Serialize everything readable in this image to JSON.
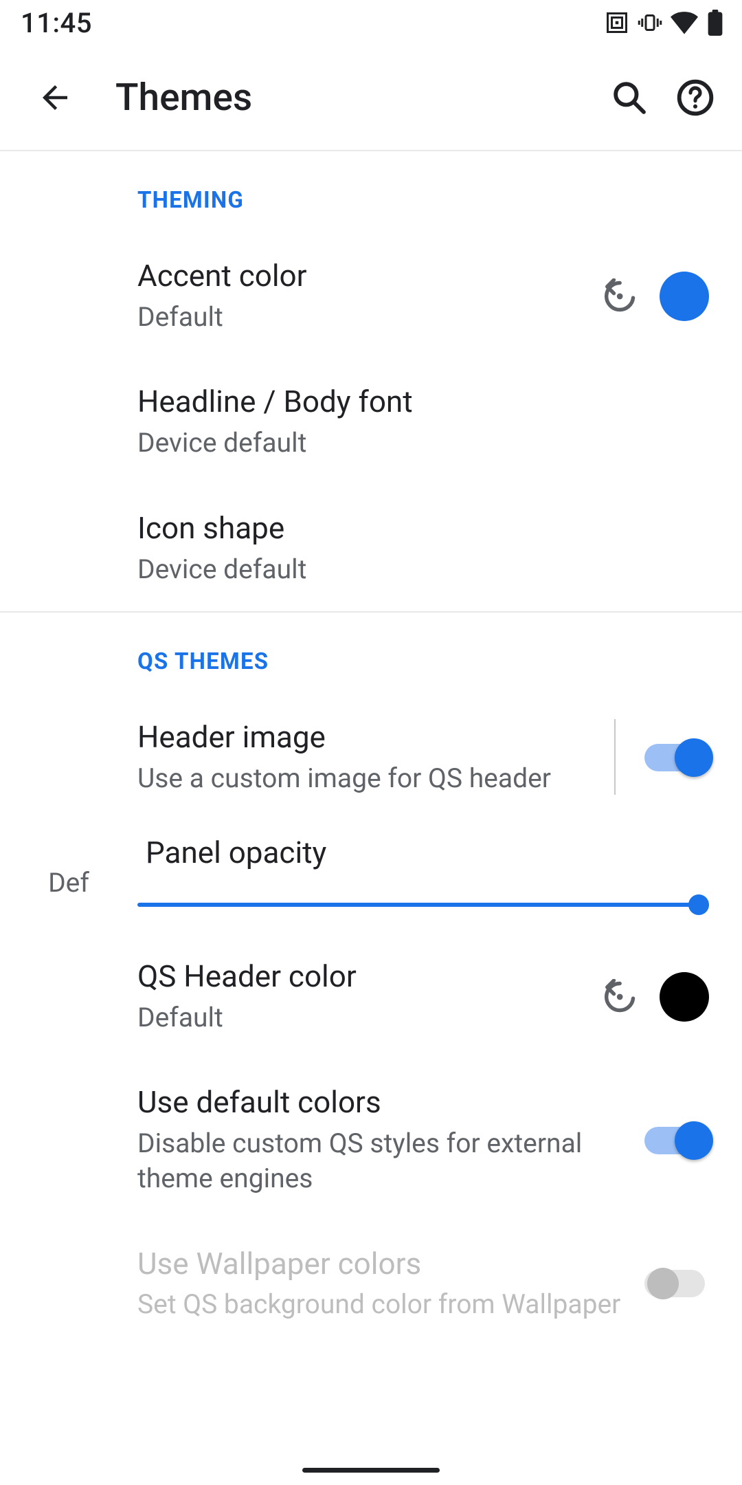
{
  "status": {
    "time": "11:45"
  },
  "appbar": {
    "title": "Themes"
  },
  "sections": {
    "theming": {
      "header": "THEMING",
      "accent_color": {
        "title": "Accent color",
        "summary": "Default",
        "swatch": "#1a73e8"
      },
      "font": {
        "title": "Headline / Body font",
        "summary": "Device default"
      },
      "icon_shape": {
        "title": "Icon shape",
        "summary": "Device default"
      }
    },
    "qs": {
      "header": "QS THEMES",
      "header_image": {
        "title": "Header image",
        "summary": "Use a custom image for QS header",
        "on": true
      },
      "panel_opacity": {
        "title": "Panel opacity",
        "left_label": "Def",
        "value": 100
      },
      "qs_header_color": {
        "title": "QS Header color",
        "summary": "Default",
        "swatch": "#000000"
      },
      "use_default_colors": {
        "title": "Use default colors",
        "summary": "Disable custom QS styles for external theme engines",
        "on": true
      },
      "use_wallpaper_colors": {
        "title": "Use Wallpaper colors",
        "summary": "Set QS background color from Wallpaper",
        "on": false,
        "disabled": true
      }
    }
  }
}
